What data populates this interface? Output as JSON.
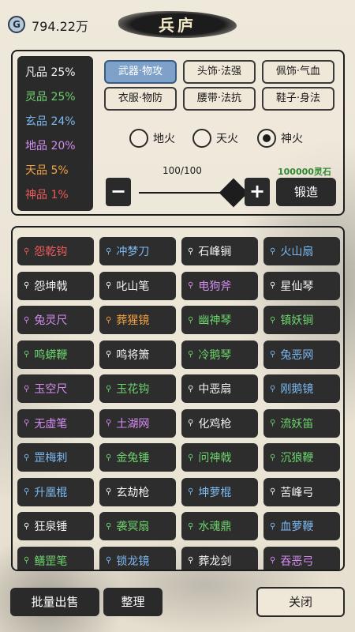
{
  "header": {
    "coin_icon": "G",
    "coins": "794.22万",
    "title": "兵庐"
  },
  "qualities": [
    {
      "label": "凡品 25%",
      "color": "#f2f2f2"
    },
    {
      "label": "灵品 25%",
      "color": "#6dd36d"
    },
    {
      "label": "玄品 24%",
      "color": "#7cb8f0"
    },
    {
      "label": "地品 20%",
      "color": "#d48cf0"
    },
    {
      "label": "天品 5%",
      "color": "#f0a040"
    },
    {
      "label": "神品 1%",
      "color": "#f05a5a"
    }
  ],
  "tabs": [
    "武器·物攻",
    "头饰·法强",
    "佩饰·气血",
    "衣服·物防",
    "腰带·法抗",
    "鞋子·身法"
  ],
  "fire_options": [
    {
      "label": "地火",
      "checked": false
    },
    {
      "label": "天火",
      "checked": false
    },
    {
      "label": "神火",
      "checked": true
    }
  ],
  "forge": {
    "quantity": "100/100",
    "cost": "100000灵石",
    "minus": "−",
    "plus": "+",
    "button": "锻造",
    "slider_fraction": 1.0
  },
  "items": [
    {
      "name": "怨乾钩",
      "color": "#f05a5a"
    },
    {
      "name": "冲梦刀",
      "color": "#7cb8f0"
    },
    {
      "name": "石峰锏",
      "color": "#f2f2f2"
    },
    {
      "name": "火山扇",
      "color": "#7cb8f0"
    },
    {
      "name": "怨坤戟",
      "color": "#f2f2f2"
    },
    {
      "name": "叱山笔",
      "color": "#f2f2f2"
    },
    {
      "name": "电狗斧",
      "color": "#d48cf0"
    },
    {
      "name": "星仙琴",
      "color": "#f2f2f2"
    },
    {
      "name": "兔灵尺",
      "color": "#d48cf0"
    },
    {
      "name": "葬猩镜",
      "color": "#f0a040"
    },
    {
      "name": "幽神琴",
      "color": "#6dd36d"
    },
    {
      "name": "镇妖锏",
      "color": "#6dd36d"
    },
    {
      "name": "鸣蟒鞭",
      "color": "#6dd36d"
    },
    {
      "name": "鸣将箫",
      "color": "#f2f2f2"
    },
    {
      "name": "冷鹅琴",
      "color": "#6dd36d"
    },
    {
      "name": "兔恶网",
      "color": "#7cb8f0"
    },
    {
      "name": "玉空尺",
      "color": "#d48cf0"
    },
    {
      "name": "玉花钩",
      "color": "#6dd36d"
    },
    {
      "name": "中恶扇",
      "color": "#f2f2f2"
    },
    {
      "name": "刚鹅镜",
      "color": "#7cb8f0"
    },
    {
      "name": "无虚笔",
      "color": "#d48cf0"
    },
    {
      "name": "土湖网",
      "color": "#d48cf0"
    },
    {
      "name": "化鸡枪",
      "color": "#f2f2f2"
    },
    {
      "name": "流妖笛",
      "color": "#6dd36d"
    },
    {
      "name": "罡梅刺",
      "color": "#7cb8f0"
    },
    {
      "name": "金兔锤",
      "color": "#6dd36d"
    },
    {
      "name": "问神戟",
      "color": "#6dd36d"
    },
    {
      "name": "沉狼鞭",
      "color": "#6dd36d"
    },
    {
      "name": "升凰棍",
      "color": "#7cb8f0"
    },
    {
      "name": "玄劫枪",
      "color": "#f2f2f2"
    },
    {
      "name": "坤萝棍",
      "color": "#7cb8f0"
    },
    {
      "name": "苦峰弓",
      "color": "#f2f2f2"
    },
    {
      "name": "狂泉锤",
      "color": "#f2f2f2"
    },
    {
      "name": "袭冥扇",
      "color": "#6dd36d"
    },
    {
      "name": "水魂鼎",
      "color": "#6dd36d"
    },
    {
      "name": "血萝鞭",
      "color": "#7cb8f0"
    },
    {
      "name": "鳝罡笔",
      "color": "#6dd36d"
    },
    {
      "name": "锁龙镜",
      "color": "#7cb8f0"
    },
    {
      "name": "葬龙剑",
      "color": "#f2f2f2"
    },
    {
      "name": "吞恶弓",
      "color": "#d48cf0"
    }
  ],
  "bottom": {
    "sell": "批量出售",
    "sort": "整理",
    "close": "关闭"
  }
}
